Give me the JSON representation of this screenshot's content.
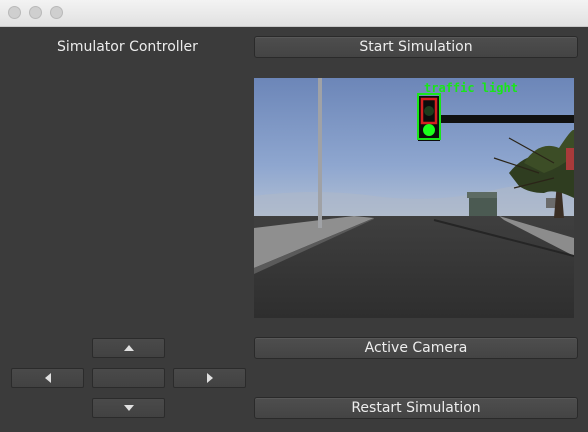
{
  "window": {
    "title_bar_buttons": [
      "close",
      "minimize",
      "maximize"
    ]
  },
  "controller": {
    "title": "Simulator Controller"
  },
  "buttons": {
    "start": "Start Simulation",
    "active_camera": "Active Camera",
    "restart": "Restart Simulation"
  },
  "dpad": {
    "up_icon": "triangle-up-icon",
    "down_icon": "triangle-down-icon",
    "left_icon": "triangle-left-icon",
    "right_icon": "triangle-right-icon",
    "center_label": ""
  },
  "camera": {
    "detection_label": "traffic light",
    "detection_color": "#19e619"
  },
  "colors": {
    "window_bg": "#3b3b3b",
    "button_text": "#ededed"
  }
}
